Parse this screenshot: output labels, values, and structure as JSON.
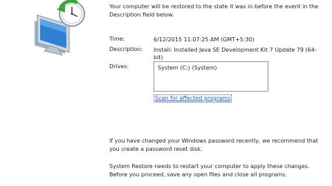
{
  "intro": "Your computer will be restored to the state it was in before the event in the Description field below.",
  "details": {
    "time_label": "Time:",
    "time_value": "6/12/2015 11:07:25 AM (GMT+5:30)",
    "description_label": "Description:",
    "description_value": "Install: Installed Java SE Development Kit 7 Update 79 (64-bit)",
    "drives_label": "Drives:",
    "drives": [
      "System (C:) (System)"
    ]
  },
  "scan_link": "Scan for affected programs",
  "password_note": "If you have changed your Windows password recently, we recommend that you create a password reset disk.",
  "restart_note": "System Restore needs to restart your computer to apply these changes. Before you proceed, save any open files and close all programs.",
  "icon": "system-restore-icon"
}
